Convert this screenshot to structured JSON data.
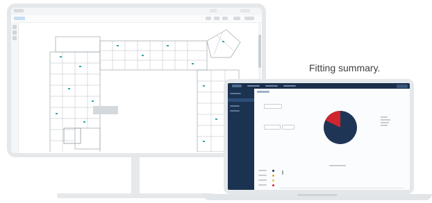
{
  "caption": "Fitting summary.",
  "colors": {
    "device_frame": "#e5e8ea",
    "laptop_nav": "#1a2f4a",
    "laptop_sidebar": "#1b3350",
    "pie_primary": "#1f3556",
    "pie_accent": "#d0242f",
    "plan_line": "#9aa3a8",
    "plan_accent": "#32a4a8"
  },
  "icons": {
    "monitor": "desktop-monitor-icon",
    "laptop": "laptop-icon"
  }
}
